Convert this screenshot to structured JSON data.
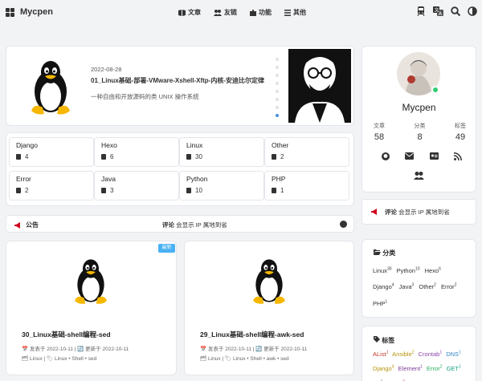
{
  "nav": {
    "brand": "Mycpen",
    "menu": [
      "文章",
      "友链",
      "功能",
      "其他"
    ],
    "icons": [
      "train-icon",
      "translate-icon",
      "search-icon",
      "darkmode-icon"
    ]
  },
  "featured": {
    "date": "2022-08-28",
    "title": "01_Linux基础-部署-VMware-Xshell-Xftp-内核-安迪比尔定律",
    "desc": "一种自由和开放源码的类 UNIX 操作系统"
  },
  "categories": [
    {
      "name": "Django",
      "count": "4"
    },
    {
      "name": "Hexo",
      "count": "6"
    },
    {
      "name": "Linux",
      "count": "30"
    },
    {
      "name": "Other",
      "count": "2"
    },
    {
      "name": "Error",
      "count": "2"
    },
    {
      "name": "Java",
      "count": "3"
    },
    {
      "name": "Python",
      "count": "10"
    },
    {
      "name": "PHP",
      "count": "1"
    }
  ],
  "announcement": {
    "label": "公告",
    "bold": "评论",
    "text": " 会显示 IP 属地到省"
  },
  "posts": [
    {
      "badge": "最新",
      "title": "30_Linux基础-shell编程-sed",
      "meta1": "📅 发表于 2022-10-11 | 🔄 更新于 2022-10-11",
      "meta2": "🗂 Linux | 🏷 Linux • Shell • sed"
    },
    {
      "title": "29_Linux基础-shell编程-awk-sed",
      "meta1": "📅 发表于 2022-10-11 | 🔄 更新于 2022-10-11",
      "meta2": "🗂 Linux | 🏷 Linux • Shell • awk • sed"
    }
  ],
  "profile": {
    "name": "Mycpen",
    "stats": [
      {
        "label": "文章",
        "value": "58"
      },
      {
        "label": "分类",
        "value": "8"
      },
      {
        "label": "标签",
        "value": "49"
      }
    ]
  },
  "side_ann": {
    "bold": "评论",
    "text": " 会显示 IP 属地到省"
  },
  "side_categories": {
    "title": "分类",
    "items": [
      {
        "name": "Linux",
        "count": "30"
      },
      {
        "name": "Python",
        "count": "10"
      },
      {
        "name": "Hexo",
        "count": "6"
      },
      {
        "name": "Django",
        "count": "4"
      },
      {
        "name": "Java",
        "count": "3"
      },
      {
        "name": "Other",
        "count": "2"
      },
      {
        "name": "Error",
        "count": "2"
      },
      {
        "name": "PHP",
        "count": "1"
      }
    ]
  },
  "tags": {
    "title": "标签",
    "items": [
      {
        "name": "AList",
        "count": "1",
        "color": "#c0392b"
      },
      {
        "name": "Ansible",
        "count": "2",
        "color": "#b7950b"
      },
      {
        "name": "Crontab",
        "count": "1",
        "color": "#8e44ad"
      },
      {
        "name": "DNS",
        "count": "1",
        "color": "#2e86c1"
      },
      {
        "name": "Django",
        "count": "4",
        "color": "#b7950b"
      },
      {
        "name": "Element",
        "count": "1",
        "color": "#7d3c98"
      },
      {
        "name": "Error",
        "count": "2",
        "color": "#27ae60"
      },
      {
        "name": "GET",
        "count": "1",
        "color": "#16a085"
      },
      {
        "name": "Git",
        "count": "2",
        "color": "#7f8c8d"
      },
      {
        "name": "HTTP",
        "count": "2",
        "color": "#c0392b"
      }
    ]
  }
}
